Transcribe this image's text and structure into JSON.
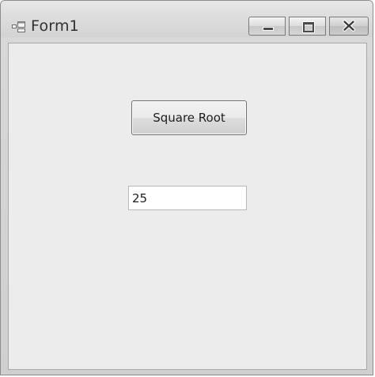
{
  "window": {
    "title": "Form1",
    "controls": {
      "minimize": "minimize-icon",
      "maximize": "maximize-icon",
      "close": "close-icon"
    }
  },
  "form": {
    "button_label": "Square Root",
    "input_value": "25"
  }
}
